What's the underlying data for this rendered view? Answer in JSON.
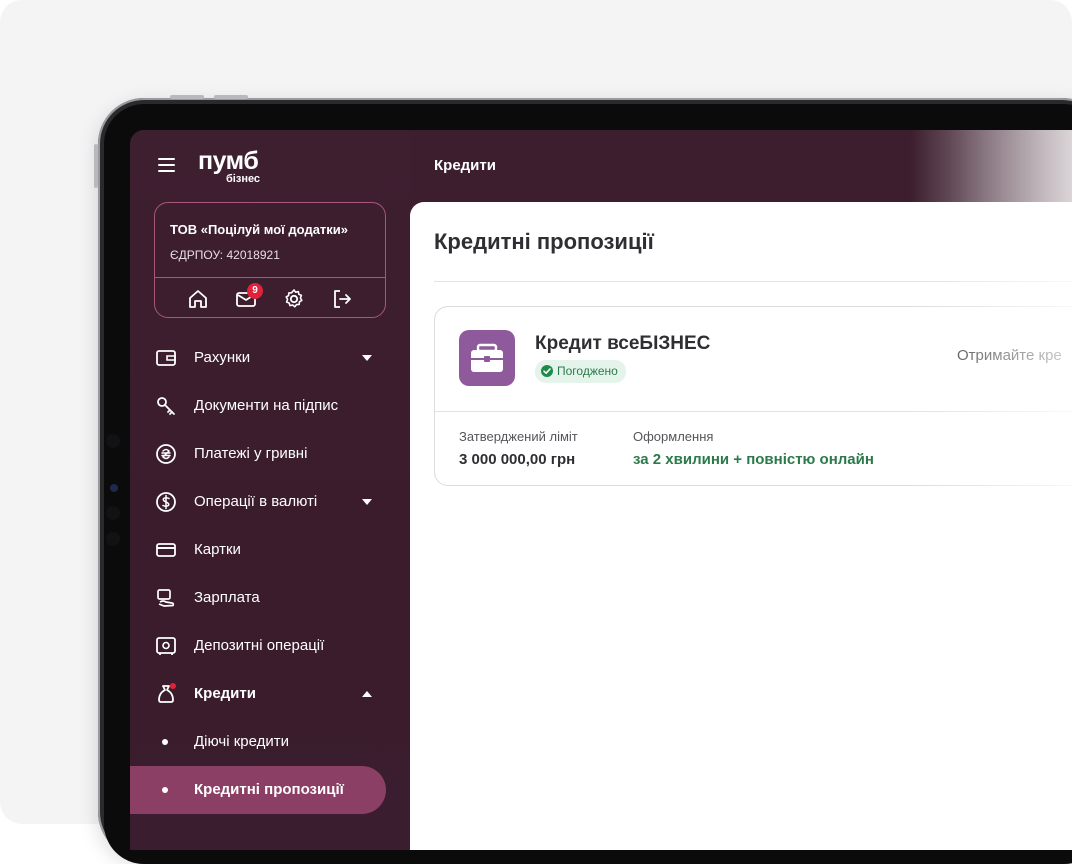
{
  "app": {
    "logo": "пумб",
    "logo_sub": "бізнес",
    "page_heading": "Кредити"
  },
  "company": {
    "name": "ТОВ «Поцілуй мої додатки»",
    "code": "ЄДРПОУ: 42018921",
    "mail_badge": "9"
  },
  "nav": {
    "items": [
      {
        "label": "Рахунки",
        "icon": "wallet-icon",
        "caret": "down"
      },
      {
        "label": "Документи на підпис",
        "icon": "key-icon"
      },
      {
        "label": "Платежі у гривні",
        "icon": "hryvnia-icon"
      },
      {
        "label": "Операції в валюті",
        "icon": "dollar-icon",
        "caret": "down"
      },
      {
        "label": "Картки",
        "icon": "card-icon"
      },
      {
        "label": "Зарплата",
        "icon": "salary-icon"
      },
      {
        "label": "Депозитні операції",
        "icon": "safe-icon"
      },
      {
        "label": "Кредити",
        "icon": "money-bag-icon",
        "caret": "up"
      }
    ],
    "sub_items": [
      {
        "label": "Діючі кредити"
      },
      {
        "label": "Кредитні пропозиції",
        "active": true
      }
    ]
  },
  "main": {
    "title": "Кредитні пропозиції",
    "offer": {
      "name": "Кредит всеБІЗНЕС",
      "status": "Погоджено",
      "cta": "Отримайте кре",
      "limit_label": "Затверджений ліміт",
      "limit_value": "3 000 000,00 грн",
      "process_label": "Оформлення",
      "process_value": "за 2 хвилини + повністю онлайн"
    }
  },
  "colors": {
    "sidebar": "#3c1e2e",
    "accent": "#8c3f64",
    "offer_icon_bg": "#8e5a9c",
    "status_green": "#2c7a4b",
    "badge_red": "#e0233b"
  }
}
